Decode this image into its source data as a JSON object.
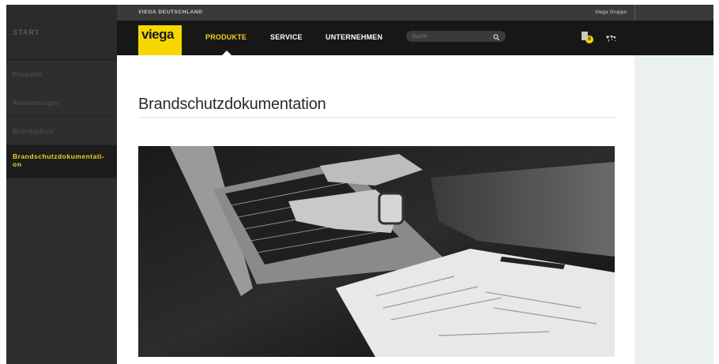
{
  "topbar": {
    "left": "VIEGA DEUTSCHLAND",
    "right": "Viega Gruppe"
  },
  "logo": {
    "text": "viega"
  },
  "nav": {
    "items": [
      {
        "label": "PRODUKTE",
        "active": true
      },
      {
        "label": "SERVICE",
        "active": false
      },
      {
        "label": "UNTERNEHMEN",
        "active": false
      }
    ],
    "search_placeholder": "Suche",
    "cart_count": "0"
  },
  "sidebar": {
    "start": "START",
    "items": [
      {
        "label": "Produkte"
      },
      {
        "label": "Anwendungen"
      },
      {
        "label": "Brandschutz"
      },
      {
        "label": "Brandschutzdokumentati-on",
        "active": true
      }
    ]
  },
  "main": {
    "title": "Brandschutzdokumentation"
  },
  "colors": {
    "accent": "#f2d21a",
    "brand_yellow": "#f6d700",
    "dark": "#171717",
    "panel": "#ebf2ee"
  },
  "icons": [
    "search-icon",
    "document-cart-icon",
    "world-map-icon"
  ]
}
